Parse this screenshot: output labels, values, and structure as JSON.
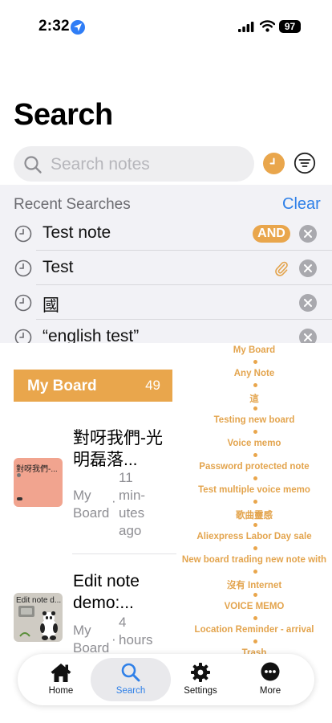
{
  "status_bar": {
    "time": "2:32",
    "battery": "97"
  },
  "page": {
    "title": "Search"
  },
  "search": {
    "placeholder": "Search notes",
    "value": ""
  },
  "recent": {
    "header": "Recent Searches",
    "clear_label": "Clear",
    "items": [
      {
        "text": "Test note",
        "badge": "AND"
      },
      {
        "text": "Test",
        "icon": "paperclip-icon"
      },
      {
        "text": "國"
      },
      {
        "text": "“english test”"
      }
    ]
  },
  "board": {
    "name": "My Board",
    "count": "49"
  },
  "notes": [
    {
      "title_lines": [
        "對呀我們-光",
        "明磊落..."
      ],
      "thumb_text": "對呀我們-...",
      "board_lines": [
        "My",
        "Board"
      ],
      "time_lines": [
        "11",
        "min-",
        "utes",
        "ago"
      ]
    },
    {
      "title_lines": [
        "Edit note",
        "demo:..."
      ],
      "thumb_text": "Edit note d...",
      "board_lines": [
        "My",
        "Board"
      ],
      "time_lines": [
        "4",
        "hours"
      ]
    }
  ],
  "timeline": [
    "My Board",
    "Any Note",
    "這",
    "Testing new board",
    "Voice memo",
    "Password protected note",
    "Test multiple voice memo",
    "歌曲靈感",
    "Aliexpress Labor Day sale",
    "New board trading new note with",
    "沒有 Internet",
    "VOICE MEMO",
    "Location Reminder - arrival",
    "Trash"
  ],
  "tabbar": {
    "tabs": [
      {
        "label": "Home",
        "icon": "house-icon"
      },
      {
        "label": "Search",
        "icon": "magnifier-icon",
        "active": true
      },
      {
        "label": "Settings",
        "icon": "gear-icon"
      },
      {
        "label": "More",
        "icon": "ellipsis-circle-icon"
      }
    ]
  },
  "colors": {
    "accent": "#e9a64c",
    "link": "#2f80e8",
    "panel": "#f2f2f6"
  }
}
